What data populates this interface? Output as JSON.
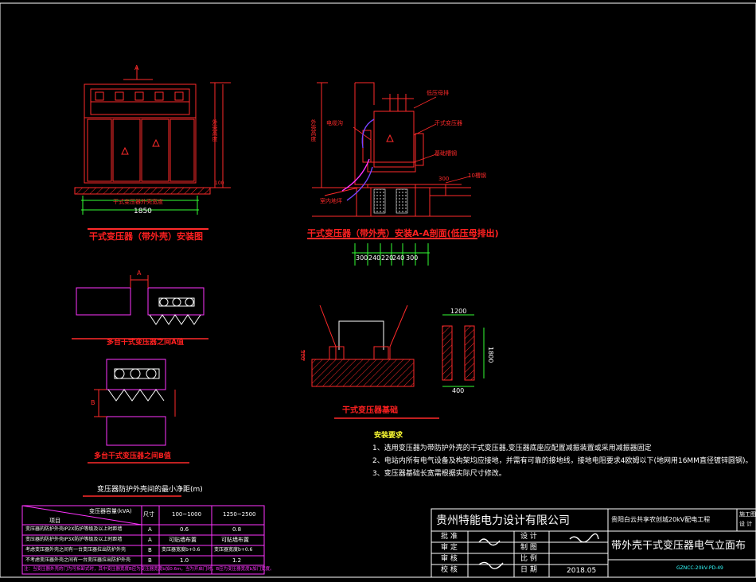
{
  "drawing": {
    "view1": {
      "label_a": "A",
      "width_dim": "1850",
      "dim_inner": "干式变压器外壳宽度",
      "height_dim": "外壳高度",
      "base_dim": "100",
      "title": "干式变压器（带外壳）安装图"
    },
    "view2": {
      "callout_lv_bus": "低压母排",
      "callout_cable": "电缆沟",
      "callout_transformer": "干式变压器",
      "callout_base": "基础槽钢",
      "callout_channel": "10槽钢",
      "callout_ground": "室内地坪",
      "height_dim": "外壳高度",
      "dim_300": "300",
      "bottom_dims": [
        "300",
        "240",
        "220",
        "240",
        "300"
      ],
      "title": "干式变压器（带外壳）安装A-A剖面(低压母排出)"
    },
    "view3": {
      "label_a": "A",
      "title": "多台干式变压器之间A值"
    },
    "view4": {
      "label_b": "B",
      "title": "多台干式变压器之间B值"
    },
    "view5": {
      "dim_left": "300",
      "title": "干式变压器基础"
    },
    "view6": {
      "dim_top": "1200",
      "dim_right": "1800",
      "dim_bottom": "400"
    },
    "requirements": {
      "heading": "安装要求",
      "items": [
        "1、选用变压器为带防护外壳的干式变压器,变压器底座应配置减振装置或采用减振器固定",
        "2、电站内所有电气设备及构架均应接地，并需有可靠的接地线，接地电阻要求4欧姆以下(地网用16MM直径镀锌圆钢)。",
        "3、变压器基础长宽需根据实际尺寸修改。"
      ]
    },
    "clearance_table": {
      "title": "变压器防护外壳间的最小净距(m)",
      "header_item": "项目",
      "header_capacity": "变压器容量(kVA)",
      "header_size": "尺寸",
      "col1": "100~1000",
      "col2": "1250~2500",
      "rows": [
        {
          "item": "变压器的防护外壳IP2X防护等级及以上时距墙",
          "size": "A",
          "v1": "0.6",
          "v2": "0.8"
        },
        {
          "item": "变压器的防护外壳IP3X防护等级及以上时距墙",
          "size": "A",
          "v1": "可贴墙布置",
          "v2": "可贴墙布置"
        },
        {
          "item": "考虑变压器外壳之间有一台变压器拉出防护外壳",
          "size": "B",
          "v1": "变压器宽度b+0.6",
          "v2": "变压器宽度b+0.6"
        },
        {
          "item": "不考虑变压器外壳之间有一台变压器拉出防护外壳",
          "size": "B",
          "v1": "1.0",
          "v2": "1.2"
        }
      ],
      "note": "注：当变压器外壳的门为可拆卸式时，其中变压器宽度B应为变压器宽度b加0.6m，当为开启门时，B应为变压器宽度b加门宽度。"
    },
    "title_block": {
      "company": "贵州特能电力设计有限公司",
      "project": "贵阳白云共享农创城20kV配电工程",
      "stage_1": "施工图",
      "stage_2": "设 计",
      "sheet_title": "带外壳干式变压器电气立面布",
      "roles": [
        "批 准",
        "审 定",
        "审 核",
        "校 核"
      ],
      "roles2": [
        "设 计",
        "制 图",
        "比 例",
        "日 期"
      ],
      "date": "2018.05",
      "drawing_no": "GZNCC-20kV-PD-49"
    }
  },
  "colors": {
    "red": "#ff2a2a",
    "magenta": "#ff33ff",
    "green": "#33ff33",
    "yellow": "#ffff33",
    "white": "#ffffff",
    "background": "#000000"
  }
}
